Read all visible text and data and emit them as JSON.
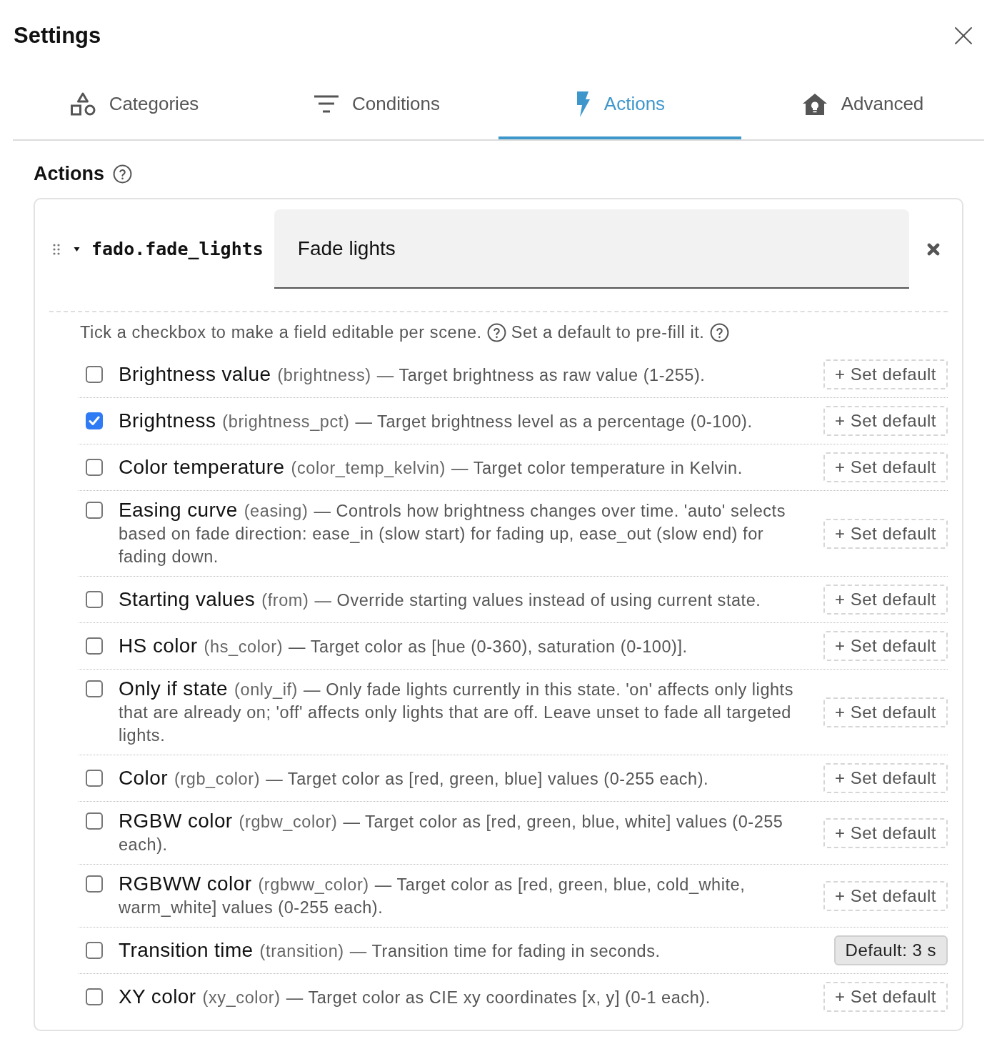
{
  "title": "Settings",
  "tabs": [
    {
      "label": "Categories",
      "selected": false
    },
    {
      "label": "Conditions",
      "selected": false
    },
    {
      "label": "Actions",
      "selected": true
    },
    {
      "label": "Advanced",
      "selected": false
    }
  ],
  "section": {
    "heading": "Actions"
  },
  "action": {
    "service": "fado.fade_lights",
    "expanded": true,
    "name": "Fade lights",
    "hints": [
      "Tick a checkbox to make a field editable per scene.",
      "Set a default to pre-fill it."
    ],
    "fields": [
      {
        "label": "Brightness value",
        "key": "(brightness)",
        "description": "— Target brightness as raw value (1-255).",
        "checked": false,
        "default": {
          "kind": "add",
          "label": "+ Set default"
        }
      },
      {
        "label": "Brightness",
        "key": "(brightness_pct)",
        "description": "— Target brightness level as a percentage (0-100).",
        "checked": true,
        "default": {
          "kind": "add",
          "label": "+ Set default"
        }
      },
      {
        "label": "Color temperature",
        "key": "(color_temp_kelvin)",
        "description": "— Target color temperature in Kelvin.",
        "checked": false,
        "default": {
          "kind": "add",
          "label": "+ Set default"
        }
      },
      {
        "label": "Easing curve",
        "key": "(easing)",
        "description": "— Controls how brightness changes over time. 'auto' selects based on fade direction: ease_in (slow start) for fading up, ease_out (slow end) for fading down.",
        "checked": false,
        "default": {
          "kind": "add",
          "label": "+ Set default"
        }
      },
      {
        "label": "Starting values",
        "key": "(from)",
        "description": "— Override starting values instead of using current state.",
        "checked": false,
        "default": {
          "kind": "add",
          "label": "+ Set default"
        }
      },
      {
        "label": "HS color",
        "key": "(hs_color)",
        "description": "— Target color as [hue (0-360), saturation (0-100)].",
        "checked": false,
        "default": {
          "kind": "add",
          "label": "+ Set default"
        }
      },
      {
        "label": "Only if state",
        "key": "(only_if)",
        "description": "— Only fade lights currently in this state. 'on' affects only lights that are already on; 'off' affects only lights that are off. Leave unset to fade all targeted lights.",
        "checked": false,
        "default": {
          "kind": "add",
          "label": "+ Set default"
        }
      },
      {
        "label": "Color",
        "key": "(rgb_color)",
        "description": "— Target color as [red, green, blue] values (0-255 each).",
        "checked": false,
        "default": {
          "kind": "add",
          "label": "+ Set default"
        }
      },
      {
        "label": "RGBW color",
        "key": "(rgbw_color)",
        "description": "— Target color as [red, green, blue, white] values (0-255 each).",
        "checked": false,
        "default": {
          "kind": "add",
          "label": "+ Set default"
        }
      },
      {
        "label": "RGBWW color",
        "key": "(rgbww_color)",
        "description": "— Target color as [red, green, blue, cold_white, warm_white] values (0-255 each).",
        "checked": false,
        "default": {
          "kind": "add",
          "label": "+ Set default"
        }
      },
      {
        "label": "Transition time",
        "key": "(transition)",
        "description": "— Transition time for fading in seconds.",
        "checked": false,
        "default": {
          "kind": "value",
          "label": "Default: 3 s"
        }
      },
      {
        "label": "XY color",
        "key": "(xy_color)",
        "description": "— Target color as CIE xy coordinates [x, y] (0-1 each).",
        "checked": false,
        "default": {
          "kind": "add",
          "label": "+ Set default"
        }
      }
    ]
  }
}
